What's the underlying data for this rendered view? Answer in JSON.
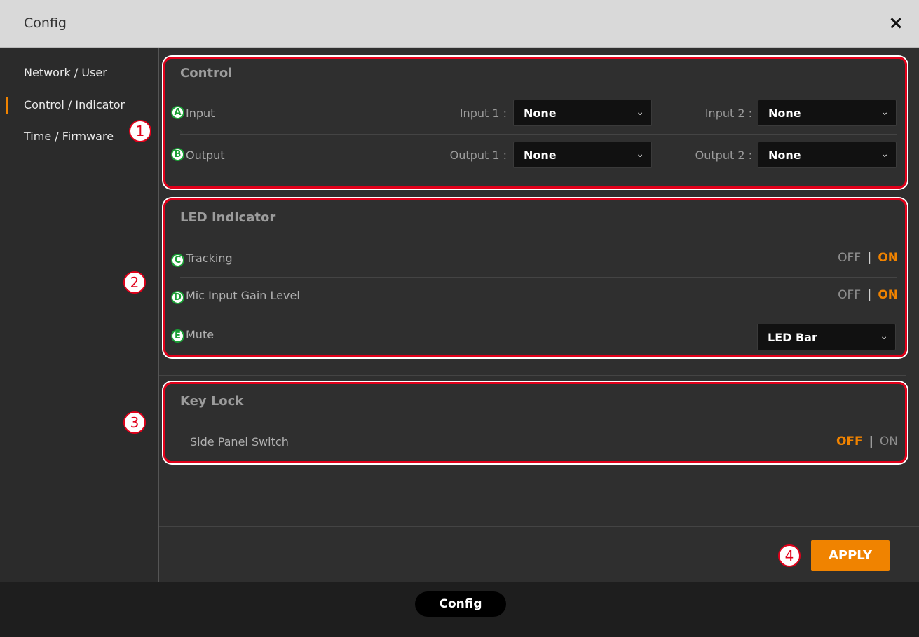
{
  "window": {
    "title": "Config",
    "close_label": "×"
  },
  "sidebar": {
    "items": [
      {
        "label": "Network / User",
        "active": false
      },
      {
        "label": "Control / Indicator",
        "active": true
      },
      {
        "label": "Time / Firmware",
        "active": false
      }
    ]
  },
  "control": {
    "title": "Control",
    "input": {
      "marker": "A",
      "label": "Input",
      "sel1_label": "Input 1 :",
      "sel1_value": "None",
      "sel2_label": "Input 2 :",
      "sel2_value": "None"
    },
    "output": {
      "marker": "B",
      "label": "Output",
      "sel1_label": "Output 1 :",
      "sel1_value": "None",
      "sel2_label": "Output 2 :",
      "sel2_value": "None"
    }
  },
  "led": {
    "title": "LED Indicator",
    "tracking": {
      "marker": "C",
      "label": "Tracking",
      "off": "OFF",
      "sep": "|",
      "on": "ON",
      "selected": "ON"
    },
    "mic_gain": {
      "marker": "D",
      "label": "Mic Input Gain Level",
      "off": "OFF",
      "sep": "|",
      "on": "ON",
      "selected": "ON"
    },
    "mute": {
      "marker": "E",
      "label": "Mute",
      "value": "LED Bar"
    }
  },
  "keylock": {
    "title": "Key Lock",
    "side_panel": {
      "label": "Side Panel Switch",
      "off": "OFF",
      "sep": "|",
      "on": "ON",
      "selected": "OFF"
    }
  },
  "callouts": [
    "1",
    "2",
    "3",
    "4"
  ],
  "apply_label": "APPLY",
  "footer_label": "Config",
  "colors": {
    "accent": "#f08300",
    "callout_red": "#e1001a",
    "marker_green": "#1aa035",
    "titlebar": "#d9d9d9"
  }
}
